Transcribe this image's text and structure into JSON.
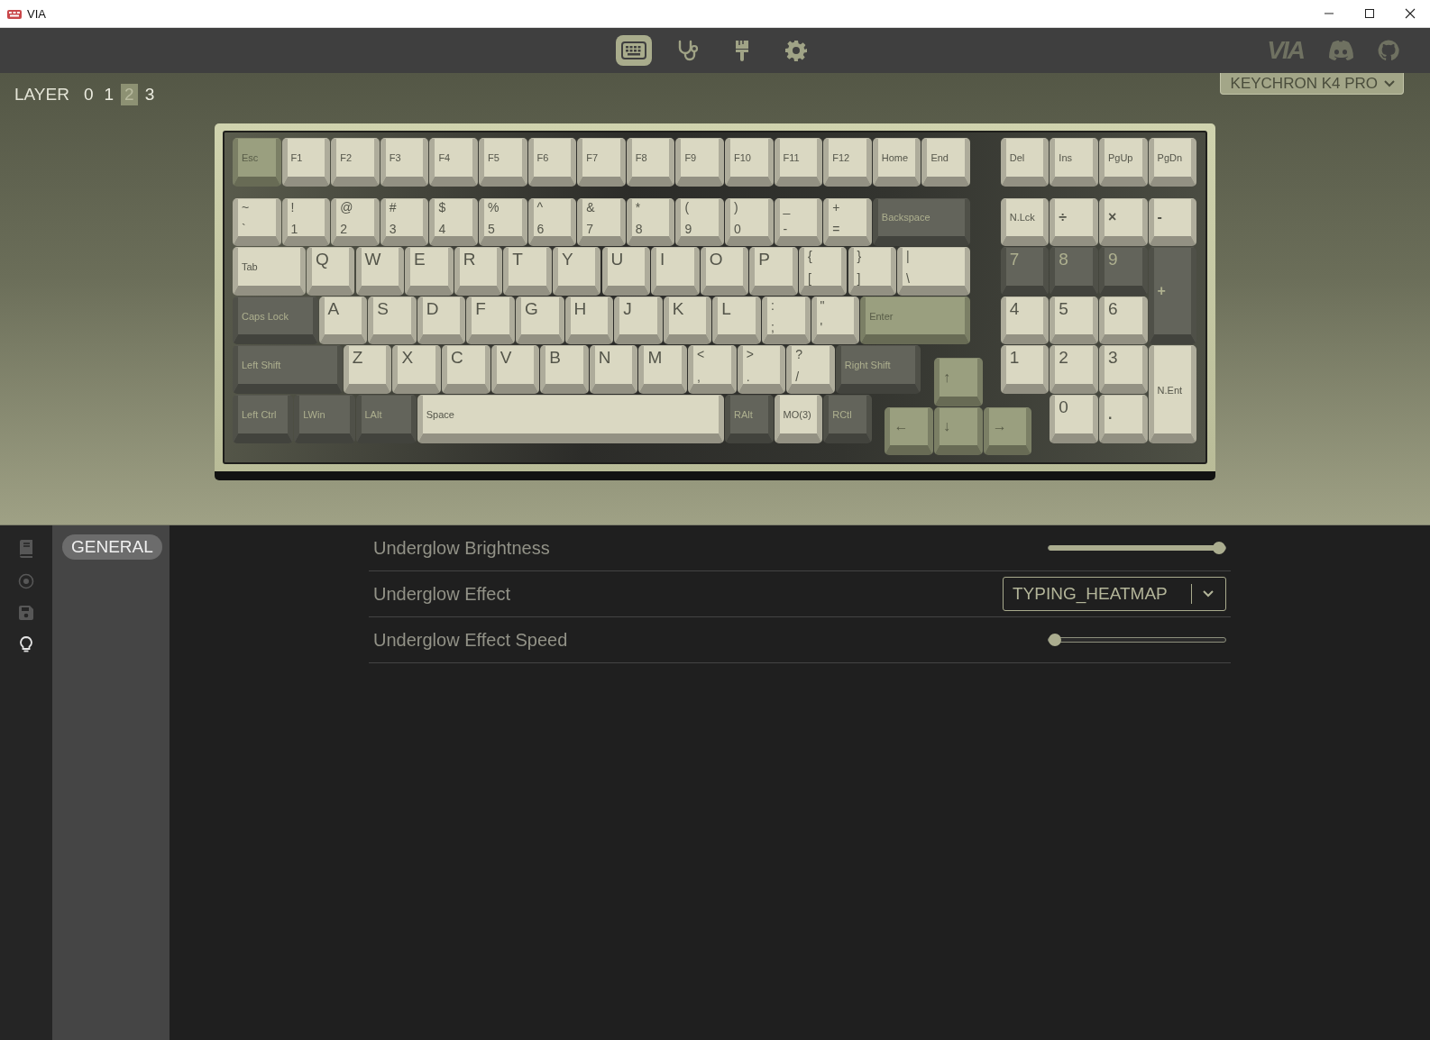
{
  "window": {
    "title": "VIA"
  },
  "toolbar": {
    "tabs": [
      {
        "kind": "keyboard",
        "selected": true
      },
      {
        "kind": "stethoscope",
        "selected": false
      },
      {
        "kind": "brush",
        "selected": false
      },
      {
        "kind": "gear",
        "selected": false
      }
    ],
    "brand": "VIA",
    "links": [
      {
        "kind": "discord"
      },
      {
        "kind": "github"
      }
    ]
  },
  "layers": {
    "label": "LAYER",
    "items": [
      {
        "label": "0",
        "selected": false
      },
      {
        "label": "1",
        "selected": false
      },
      {
        "label": "2",
        "selected": true
      },
      {
        "label": "3",
        "selected": false
      }
    ]
  },
  "device": {
    "name": "KEYCHRON K4 PRO"
  },
  "keyboard": {
    "keys": [
      {
        "legend": [
          "Esc"
        ],
        "kind": "text",
        "color": "#9a9f7f"
      },
      {
        "legend": [
          "F1"
        ],
        "kind": "text",
        "color": "#dad8c2"
      },
      {
        "legend": [
          "F2"
        ],
        "kind": "text",
        "color": "#dad8c2"
      },
      {
        "legend": [
          "F3"
        ],
        "kind": "text",
        "color": "#dad8c2"
      },
      {
        "legend": [
          "F4"
        ],
        "kind": "text",
        "color": "#dad8c2"
      },
      {
        "legend": [
          "F5"
        ],
        "kind": "text",
        "color": "#dad8c2"
      },
      {
        "legend": [
          "F6"
        ],
        "kind": "text",
        "color": "#dad8c2"
      },
      {
        "legend": [
          "F7"
        ],
        "kind": "text",
        "color": "#dad8c2"
      },
      {
        "legend": [
          "F8"
        ],
        "kind": "text",
        "color": "#dad8c2"
      },
      {
        "legend": [
          "F9"
        ],
        "kind": "text",
        "color": "#dad8c2"
      },
      {
        "legend": [
          "F10"
        ],
        "kind": "text",
        "color": "#dad8c2"
      },
      {
        "legend": [
          "F11"
        ],
        "kind": "text",
        "color": "#dad8c2"
      },
      {
        "legend": [
          "F12"
        ],
        "kind": "text",
        "color": "#dad8c2"
      },
      {
        "legend": [
          "Home"
        ],
        "kind": "text",
        "color": "#dad8c2"
      },
      {
        "legend": [
          "End"
        ],
        "kind": "text",
        "color": "#dad8c2"
      },
      {
        "legend": [
          "Del"
        ],
        "kind": "text",
        "color": "#dad8c2"
      },
      {
        "legend": [
          "Ins"
        ],
        "kind": "text",
        "color": "#dad8c2"
      },
      {
        "legend": [
          "PgUp"
        ],
        "kind": "text",
        "color": "#dad8c2"
      },
      {
        "legend": [
          "PgDn"
        ],
        "kind": "text",
        "color": "#dad8c2"
      },
      {
        "legend": [
          "~",
          "`"
        ],
        "kind": "pair",
        "color": "#dad8c2"
      },
      {
        "legend": [
          "!",
          "1"
        ],
        "kind": "pair",
        "color": "#dad8c2"
      },
      {
        "legend": [
          "@",
          "2"
        ],
        "kind": "pair",
        "color": "#dad8c2"
      },
      {
        "legend": [
          "#",
          "3"
        ],
        "kind": "pair",
        "color": "#dad8c2"
      },
      {
        "legend": [
          "$",
          "4"
        ],
        "kind": "pair",
        "color": "#dad8c2"
      },
      {
        "legend": [
          "%",
          "5"
        ],
        "kind": "pair",
        "color": "#dad8c2"
      },
      {
        "legend": [
          "^",
          "6"
        ],
        "kind": "pair",
        "color": "#dad8c2"
      },
      {
        "legend": [
          "&",
          "7"
        ],
        "kind": "pair",
        "color": "#dad8c2"
      },
      {
        "legend": [
          "*",
          "8"
        ],
        "kind": "pair",
        "color": "#dad8c2"
      },
      {
        "legend": [
          "(",
          "9"
        ],
        "kind": "pair",
        "color": "#dad8c2"
      },
      {
        "legend": [
          ")",
          "0"
        ],
        "kind": "pair",
        "color": "#dad8c2"
      },
      {
        "legend": [
          "_",
          "-"
        ],
        "kind": "pair",
        "color": "#dad8c2"
      },
      {
        "legend": [
          "+",
          "="
        ],
        "kind": "pair",
        "color": "#dad8c2"
      },
      {
        "legend": [
          "Backspace"
        ],
        "kind": "text",
        "color": "#63645b"
      },
      {
        "legend": [
          "N.Lck"
        ],
        "kind": "text",
        "color": "#dad8c2"
      },
      {
        "legend": [
          "÷"
        ],
        "kind": "symbol",
        "color": "#dad8c2"
      },
      {
        "legend": [
          "×"
        ],
        "kind": "symbol",
        "color": "#dad8c2"
      },
      {
        "legend": [
          "-"
        ],
        "kind": "symbol",
        "color": "#dad8c2"
      },
      {
        "legend": [
          "Tab"
        ],
        "kind": "text",
        "color": "#dad8c2"
      },
      {
        "legend": [
          "Q"
        ],
        "kind": "letter",
        "color": "#dad8c2"
      },
      {
        "legend": [
          "W"
        ],
        "kind": "letter",
        "color": "#dad8c2"
      },
      {
        "legend": [
          "E"
        ],
        "kind": "letter",
        "color": "#dad8c2"
      },
      {
        "legend": [
          "R"
        ],
        "kind": "letter",
        "color": "#dad8c2"
      },
      {
        "legend": [
          "T"
        ],
        "kind": "letter",
        "color": "#dad8c2"
      },
      {
        "legend": [
          "Y"
        ],
        "kind": "letter",
        "color": "#dad8c2"
      },
      {
        "legend": [
          "U"
        ],
        "kind": "letter",
        "color": "#dad8c2"
      },
      {
        "legend": [
          "I"
        ],
        "kind": "letter",
        "color": "#dad8c2"
      },
      {
        "legend": [
          "O"
        ],
        "kind": "letter",
        "color": "#dad8c2"
      },
      {
        "legend": [
          "P"
        ],
        "kind": "letter",
        "color": "#dad8c2"
      },
      {
        "legend": [
          "{",
          "["
        ],
        "kind": "pair",
        "color": "#dad8c2"
      },
      {
        "legend": [
          "}",
          "]"
        ],
        "kind": "pair",
        "color": "#dad8c2"
      },
      {
        "legend": [
          "|",
          "\\"
        ],
        "kind": "pair",
        "color": "#dad8c2"
      },
      {
        "legend": [
          "7"
        ],
        "kind": "letter",
        "color": "#63645b"
      },
      {
        "legend": [
          "8"
        ],
        "kind": "letter",
        "color": "#63645b"
      },
      {
        "legend": [
          "9"
        ],
        "kind": "letter",
        "color": "#63645b"
      },
      {
        "legend": [
          "+"
        ],
        "kind": "symbol",
        "color": "#63645b"
      },
      {
        "legend": [
          "Caps Lock"
        ],
        "kind": "text",
        "color": "#63645b"
      },
      {
        "legend": [
          "A"
        ],
        "kind": "letter",
        "color": "#dad8c2"
      },
      {
        "legend": [
          "S"
        ],
        "kind": "letter",
        "color": "#dad8c2"
      },
      {
        "legend": [
          "D"
        ],
        "kind": "letter",
        "color": "#dad8c2"
      },
      {
        "legend": [
          "F"
        ],
        "kind": "letter",
        "color": "#dad8c2"
      },
      {
        "legend": [
          "G"
        ],
        "kind": "letter",
        "color": "#dad8c2"
      },
      {
        "legend": [
          "H"
        ],
        "kind": "letter",
        "color": "#dad8c2"
      },
      {
        "legend": [
          "J"
        ],
        "kind": "letter",
        "color": "#dad8c2"
      },
      {
        "legend": [
          "K"
        ],
        "kind": "letter",
        "color": "#dad8c2"
      },
      {
        "legend": [
          "L"
        ],
        "kind": "letter",
        "color": "#dad8c2"
      },
      {
        "legend": [
          ":",
          ";"
        ],
        "kind": "pair",
        "color": "#dad8c2"
      },
      {
        "legend": [
          "\"",
          "'"
        ],
        "kind": "pair",
        "color": "#dad8c2"
      },
      {
        "legend": [
          "Enter"
        ],
        "kind": "text",
        "color": "#9a9f7f"
      },
      {
        "legend": [
          "4"
        ],
        "kind": "letter",
        "color": "#dad8c2"
      },
      {
        "legend": [
          "5"
        ],
        "kind": "letter",
        "color": "#dad8c2"
      },
      {
        "legend": [
          "6"
        ],
        "kind": "letter",
        "color": "#dad8c2"
      },
      {
        "legend": [
          "Left Shift"
        ],
        "kind": "text",
        "color": "#63645b"
      },
      {
        "legend": [
          "Z"
        ],
        "kind": "letter",
        "color": "#dad8c2"
      },
      {
        "legend": [
          "X"
        ],
        "kind": "letter",
        "color": "#dad8c2"
      },
      {
        "legend": [
          "C"
        ],
        "kind": "letter",
        "color": "#dad8c2"
      },
      {
        "legend": [
          "V"
        ],
        "kind": "letter",
        "color": "#dad8c2"
      },
      {
        "legend": [
          "B"
        ],
        "kind": "letter",
        "color": "#dad8c2"
      },
      {
        "legend": [
          "N"
        ],
        "kind": "letter",
        "color": "#dad8c2"
      },
      {
        "legend": [
          "M"
        ],
        "kind": "letter",
        "color": "#dad8c2"
      },
      {
        "legend": [
          "<",
          ","
        ],
        "kind": "pair",
        "color": "#dad8c2"
      },
      {
        "legend": [
          ">",
          "."
        ],
        "kind": "pair",
        "color": "#dad8c2"
      },
      {
        "legend": [
          "?",
          "/"
        ],
        "kind": "pair",
        "color": "#dad8c2"
      },
      {
        "legend": [
          "Right Shift"
        ],
        "kind": "text",
        "color": "#63645b"
      },
      {
        "legend": [
          "↑"
        ],
        "kind": "symbol",
        "color": "#9a9f7f"
      },
      {
        "legend": [
          "1"
        ],
        "kind": "letter",
        "color": "#dad8c2"
      },
      {
        "legend": [
          "2"
        ],
        "kind": "letter",
        "color": "#dad8c2"
      },
      {
        "legend": [
          "3"
        ],
        "kind": "letter",
        "color": "#dad8c2"
      },
      {
        "legend": [
          "N.Ent"
        ],
        "kind": "text",
        "color": "#dad8c2"
      },
      {
        "legend": [
          "Left Ctrl"
        ],
        "kind": "text",
        "color": "#63645b"
      },
      {
        "legend": [
          "LWin"
        ],
        "kind": "text",
        "color": "#63645b"
      },
      {
        "legend": [
          "LAlt"
        ],
        "kind": "text",
        "color": "#63645b"
      },
      {
        "legend": [
          "Space"
        ],
        "kind": "text",
        "color": "#dad8c2"
      },
      {
        "legend": [
          "RAlt"
        ],
        "kind": "text",
        "color": "#63645b"
      },
      {
        "legend": [
          "MO(3)"
        ],
        "kind": "text",
        "color": "#dad8c2"
      },
      {
        "legend": [
          "RCtl"
        ],
        "kind": "text",
        "color": "#63645b"
      },
      {
        "legend": [
          "←"
        ],
        "kind": "symbol",
        "color": "#9a9f7f"
      },
      {
        "legend": [
          "↓"
        ],
        "kind": "symbol",
        "color": "#9a9f7f"
      },
      {
        "legend": [
          "→"
        ],
        "kind": "symbol",
        "color": "#9a9f7f"
      },
      {
        "legend": [
          "0"
        ],
        "kind": "letter",
        "color": "#dad8c2"
      },
      {
        "legend": [
          "."
        ],
        "kind": "symbol",
        "color": "#dad8c2"
      }
    ]
  },
  "sidebar": {
    "items": [
      {
        "kind": "book",
        "selected": false
      },
      {
        "kind": "target",
        "selected": false
      },
      {
        "kind": "save",
        "selected": false
      },
      {
        "kind": "bulb",
        "selected": true
      }
    ]
  },
  "menu": {
    "items": [
      {
        "label": "GENERAL",
        "selected": true
      }
    ]
  },
  "settings": [
    {
      "kind": "slider",
      "label": "Underglow Brightness",
      "level": 1
    },
    {
      "kind": "select",
      "label": "Underglow Effect",
      "value": "TYPING_HEATMAP"
    },
    {
      "kind": "slider",
      "label": "Underglow Effect Speed",
      "level": 0
    }
  ]
}
